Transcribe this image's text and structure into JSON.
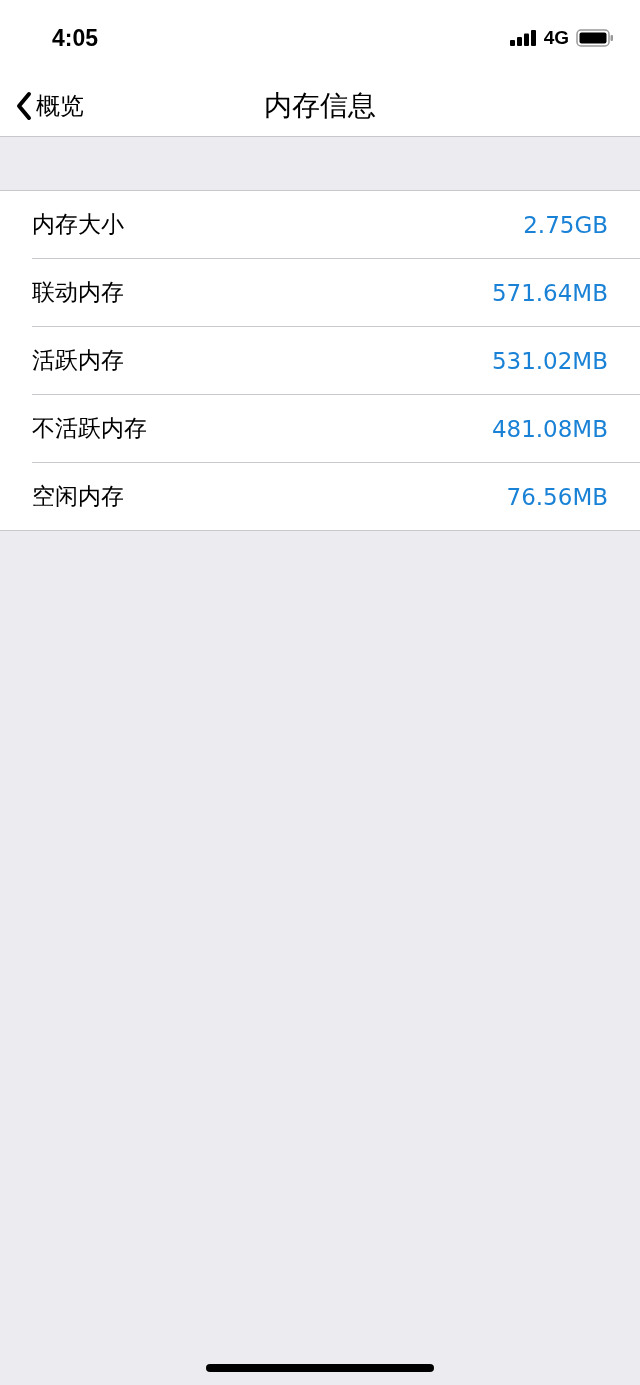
{
  "status_bar": {
    "time": "4:05",
    "network": "4G"
  },
  "nav": {
    "back_label": "概览",
    "title": "内存信息"
  },
  "rows": [
    {
      "label": "内存大小",
      "value": "2.75GB"
    },
    {
      "label": "联动内存",
      "value": "571.64MB"
    },
    {
      "label": "活跃内存",
      "value": "531.02MB"
    },
    {
      "label": "不活跃内存",
      "value": "481.08MB"
    },
    {
      "label": "空闲内存",
      "value": "76.56MB"
    }
  ]
}
